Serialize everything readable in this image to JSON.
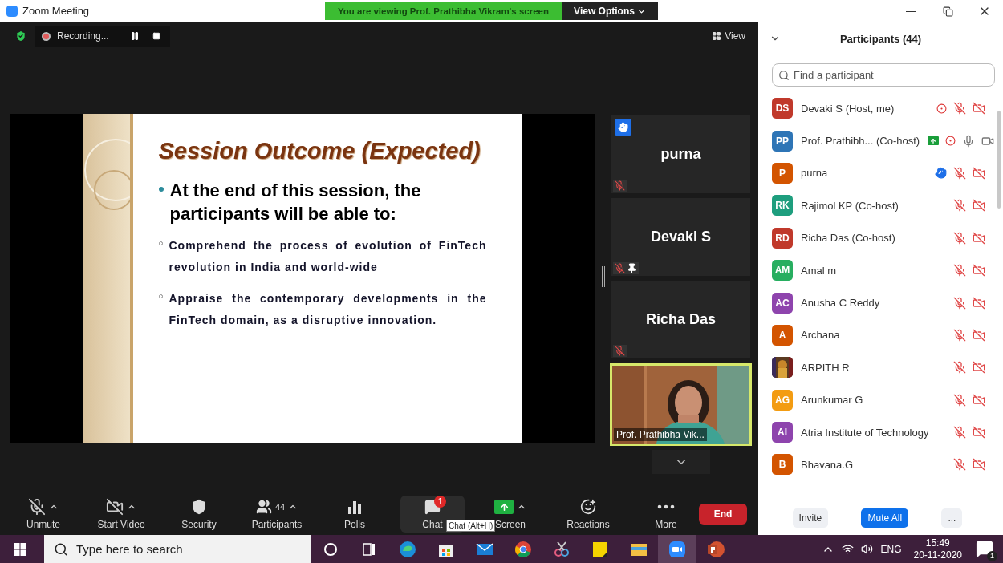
{
  "window": {
    "title": "Zoom Meeting"
  },
  "banner": {
    "text": "You are viewing Prof. Prathibha Vikram's screen",
    "options": "View Options"
  },
  "top_bar": {
    "recording": "Recording...",
    "view": "View"
  },
  "slide": {
    "title": "Session Outcome (Expected)",
    "bullet": "At the end of this session, the participants will be able to:",
    "sub_bullets": [
      "Comprehend the process of evolution of FinTech revolution in India and world-wide",
      "Appraise the contemporary developments in the FinTech domain, as a disruptive innovation."
    ]
  },
  "video_tiles": [
    {
      "kind": "name",
      "name": "purna",
      "muted": true,
      "pinned": false,
      "hand_raised": true
    },
    {
      "kind": "name",
      "name": "Devaki S",
      "muted": true,
      "pinned": true,
      "hand_raised": false
    },
    {
      "kind": "name",
      "name": "Richa Das",
      "muted": true,
      "pinned": false,
      "hand_raised": false
    },
    {
      "kind": "video",
      "name": "Prof. Prathibha Vik...",
      "muted": false,
      "pinned": false,
      "hand_raised": false
    }
  ],
  "toolbar": [
    {
      "kind": "mic",
      "label": "Unmute",
      "caret": true,
      "selected": false
    },
    {
      "kind": "video",
      "label": "Start Video",
      "caret": true,
      "selected": false
    },
    {
      "kind": "security",
      "label": "Security",
      "caret": false,
      "selected": false
    },
    {
      "kind": "participants",
      "label": "Participants",
      "count": "44",
      "caret": true,
      "selected": false
    },
    {
      "kind": "polls",
      "label": "Polls",
      "caret": false,
      "selected": false
    },
    {
      "kind": "chat",
      "label": "Chat",
      "badge": "1",
      "caret": false,
      "selected": true
    },
    {
      "kind": "share",
      "label": "Screen",
      "caret": true,
      "selected": false
    },
    {
      "kind": "reactions",
      "label": "Reactions",
      "caret": false,
      "selected": false
    },
    {
      "kind": "more",
      "label": "More",
      "caret": false,
      "selected": false
    }
  ],
  "end_button": "End",
  "tooltip": "Chat (Alt+H)",
  "participants_panel": {
    "title": "Participants (44)",
    "search_placeholder": "Find a participant",
    "participants": [
      {
        "initials": "DS",
        "name": "Devaki S (Host, me)",
        "color": "#c0392b",
        "kind": "initials",
        "recording": true,
        "sharing": false,
        "hand_raised": false,
        "muted": true,
        "video_on": false
      },
      {
        "initials": "PP",
        "name": "Prof. Prathibh... (Co-host)",
        "color": "#2e75b6",
        "kind": "initials",
        "recording": true,
        "sharing": true,
        "hand_raised": false,
        "muted": false,
        "video_on": true
      },
      {
        "initials": "P",
        "name": "purna",
        "color": "#d35400",
        "kind": "initials",
        "recording": false,
        "sharing": false,
        "hand_raised": true,
        "muted": true,
        "video_on": false
      },
      {
        "initials": "RK",
        "name": "Rajimol KP (Co-host)",
        "color": "#1e9e7e",
        "kind": "initials",
        "recording": false,
        "sharing": false,
        "hand_raised": false,
        "muted": true,
        "video_on": false
      },
      {
        "initials": "RD",
        "name": "Richa Das (Co-host)",
        "color": "#c0392b",
        "kind": "initials",
        "recording": false,
        "sharing": false,
        "hand_raised": false,
        "muted": true,
        "video_on": false
      },
      {
        "initials": "AM",
        "name": "Amal m",
        "color": "#27ae60",
        "kind": "initials",
        "recording": false,
        "sharing": false,
        "hand_raised": false,
        "muted": true,
        "video_on": false
      },
      {
        "initials": "AC",
        "name": "Anusha C Reddy",
        "color": "#8e44ad",
        "kind": "initials",
        "recording": false,
        "sharing": false,
        "hand_raised": false,
        "muted": true,
        "video_on": false
      },
      {
        "initials": "A",
        "name": "Archana",
        "color": "#d35400",
        "kind": "initials",
        "recording": false,
        "sharing": false,
        "hand_raised": false,
        "muted": true,
        "video_on": false
      },
      {
        "name": "ARPITH R",
        "kind": "picture",
        "recording": false,
        "sharing": false,
        "hand_raised": false,
        "muted": true,
        "video_on": false
      },
      {
        "initials": "AG",
        "name": "Arunkumar G",
        "color": "#f39c12",
        "kind": "initials",
        "recording": false,
        "sharing": false,
        "hand_raised": false,
        "muted": true,
        "video_on": false
      },
      {
        "initials": "AI",
        "name": "Atria Institute of Technology",
        "color": "#8e44ad",
        "kind": "initials",
        "recording": false,
        "sharing": false,
        "hand_raised": false,
        "muted": true,
        "video_on": false
      },
      {
        "initials": "B",
        "name": "Bhavana.G",
        "color": "#d35400",
        "kind": "initials",
        "recording": false,
        "sharing": false,
        "hand_raised": false,
        "muted": true,
        "video_on": false
      }
    ],
    "buttons": [
      {
        "kind": "plain",
        "label": "Invite"
      },
      {
        "kind": "primary",
        "label": "Mute All"
      },
      {
        "kind": "plain",
        "label": "..."
      }
    ]
  },
  "taskbar": {
    "search_placeholder": "Type here to search",
    "apps": [
      {
        "kind": "cortana",
        "active": false
      },
      {
        "kind": "taskview",
        "active": false
      },
      {
        "kind": "edge",
        "active": false
      },
      {
        "kind": "store",
        "active": false
      },
      {
        "kind": "mail",
        "active": false
      },
      {
        "kind": "chrome",
        "active": false
      },
      {
        "kind": "snip",
        "active": false
      },
      {
        "kind": "sticky",
        "active": false
      },
      {
        "kind": "explorer",
        "active": false
      },
      {
        "kind": "zoom",
        "active": true
      },
      {
        "kind": "powerpoint",
        "active": false
      }
    ],
    "language": "ENG",
    "time": "15:49",
    "date": "20-11-2020",
    "notifications": "1"
  }
}
